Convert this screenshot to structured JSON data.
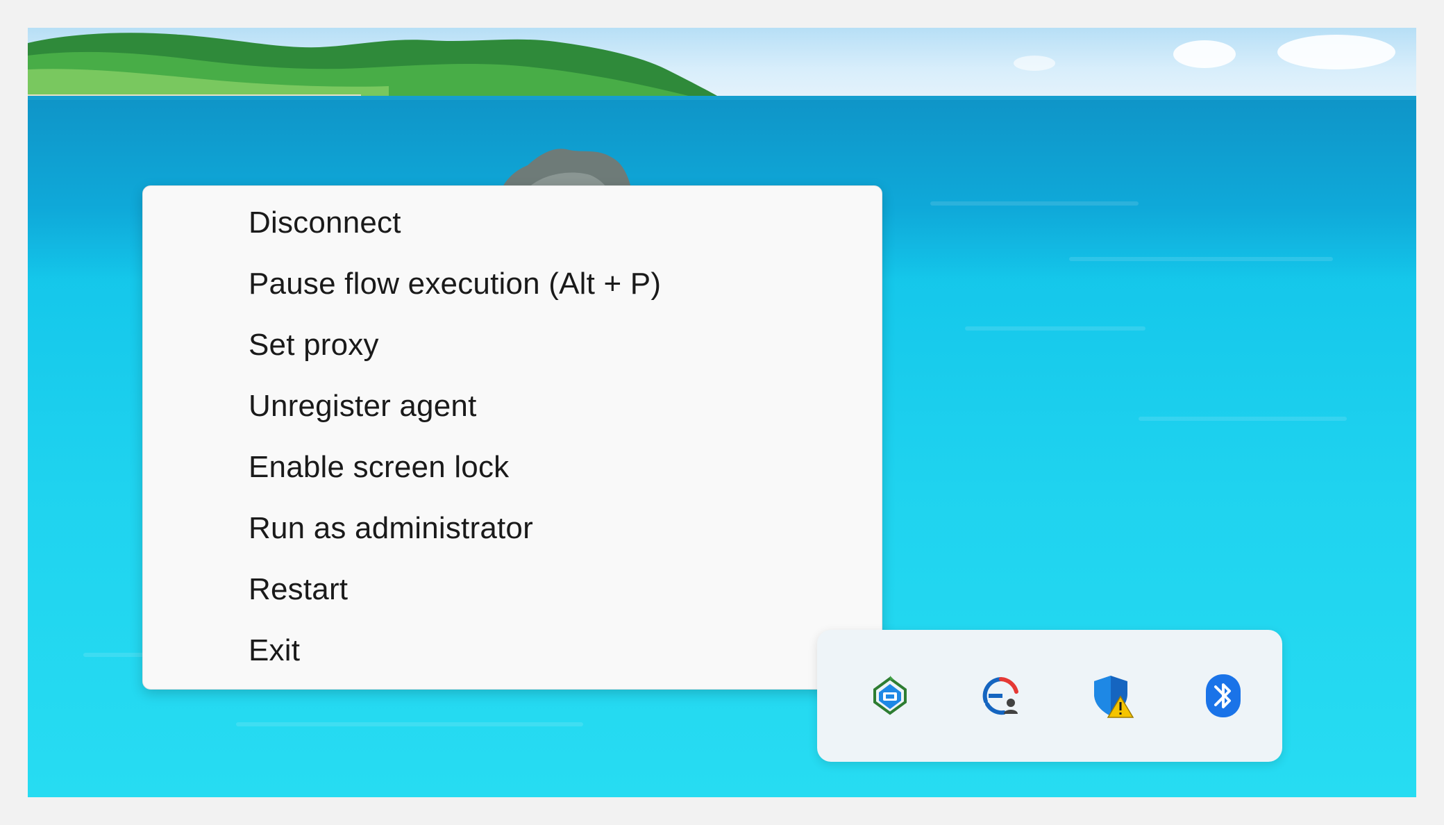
{
  "context_menu": {
    "items": [
      {
        "label": "Disconnect"
      },
      {
        "label": "Pause flow execution (Alt + P)"
      },
      {
        "label": "Set proxy"
      },
      {
        "label": "Unregister agent"
      },
      {
        "label": "Enable screen lock"
      },
      {
        "label": "Run as administrator"
      },
      {
        "label": "Restart"
      },
      {
        "label": "Exit"
      }
    ]
  },
  "tray": {
    "icons": [
      {
        "icon": "power-automate-agent-icon"
      },
      {
        "icon": "sync-user-icon"
      },
      {
        "icon": "security-warning-shield-icon"
      },
      {
        "icon": "bluetooth-icon"
      }
    ]
  },
  "colors": {
    "menu_background": "#f9f9f9",
    "menu_text": "#1a1a1a",
    "tray_background": "#eef4f8",
    "bluetooth_blue": "#1a73e8",
    "shield_blue": "#1565c0",
    "warning_yellow": "#f5c400"
  }
}
